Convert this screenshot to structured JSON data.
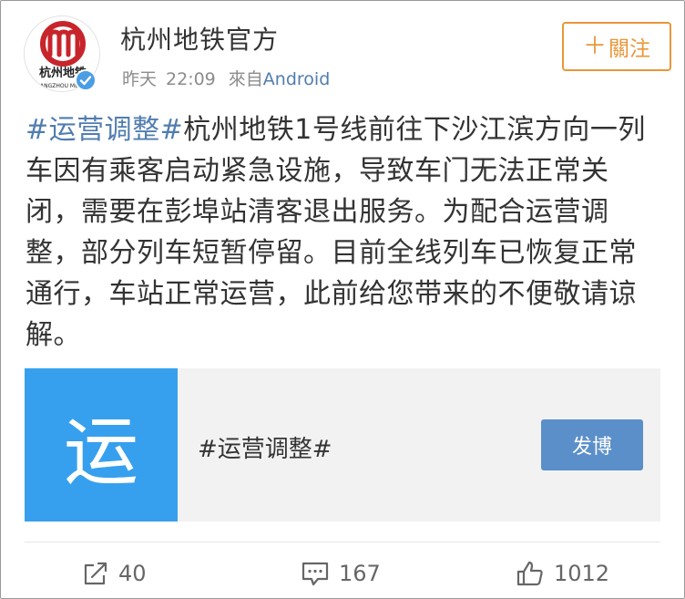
{
  "header": {
    "account_name": "杭州地铁官方",
    "time_label": "昨天",
    "time_value": "22:09",
    "from_label": "來自",
    "source": "Android",
    "follow_label": "關注",
    "follow_plus": "＋",
    "avatar_logo_text": "杭州地铁",
    "avatar_logo_subtext": "HANGZHOU METRO"
  },
  "post": {
    "hashtag": "#运营调整#",
    "text": "杭州地铁1号线前往下沙江滨方向一列车因有乘客启动紧急设施，导致车门无法正常关闭，需要在彭埠站清客退出服务。为配合运营调整，部分列车短暂停留。目前全线列车已恢复正常通行，车站正常运营，此前给您带来的不便敬请谅解。"
  },
  "topic_card": {
    "thumb_char": "运",
    "title": "#运营调整#",
    "button_label": "发博"
  },
  "actions": {
    "repost_count": "40",
    "comment_count": "167",
    "like_count": "1012"
  },
  "colors": {
    "link_blue": "#507daf",
    "follow_orange": "#e8973a",
    "card_thumb_blue": "#37a0ee",
    "card_button_blue": "#5b8fc9",
    "verified_blue": "#4b9ee3",
    "logo_red": "#c8242b"
  },
  "icons": {
    "avatar": "hangzhou-metro-logo",
    "verified": "verified-badge-icon",
    "repost": "repost-icon",
    "comment": "comment-icon",
    "like": "thumbs-up-icon"
  }
}
